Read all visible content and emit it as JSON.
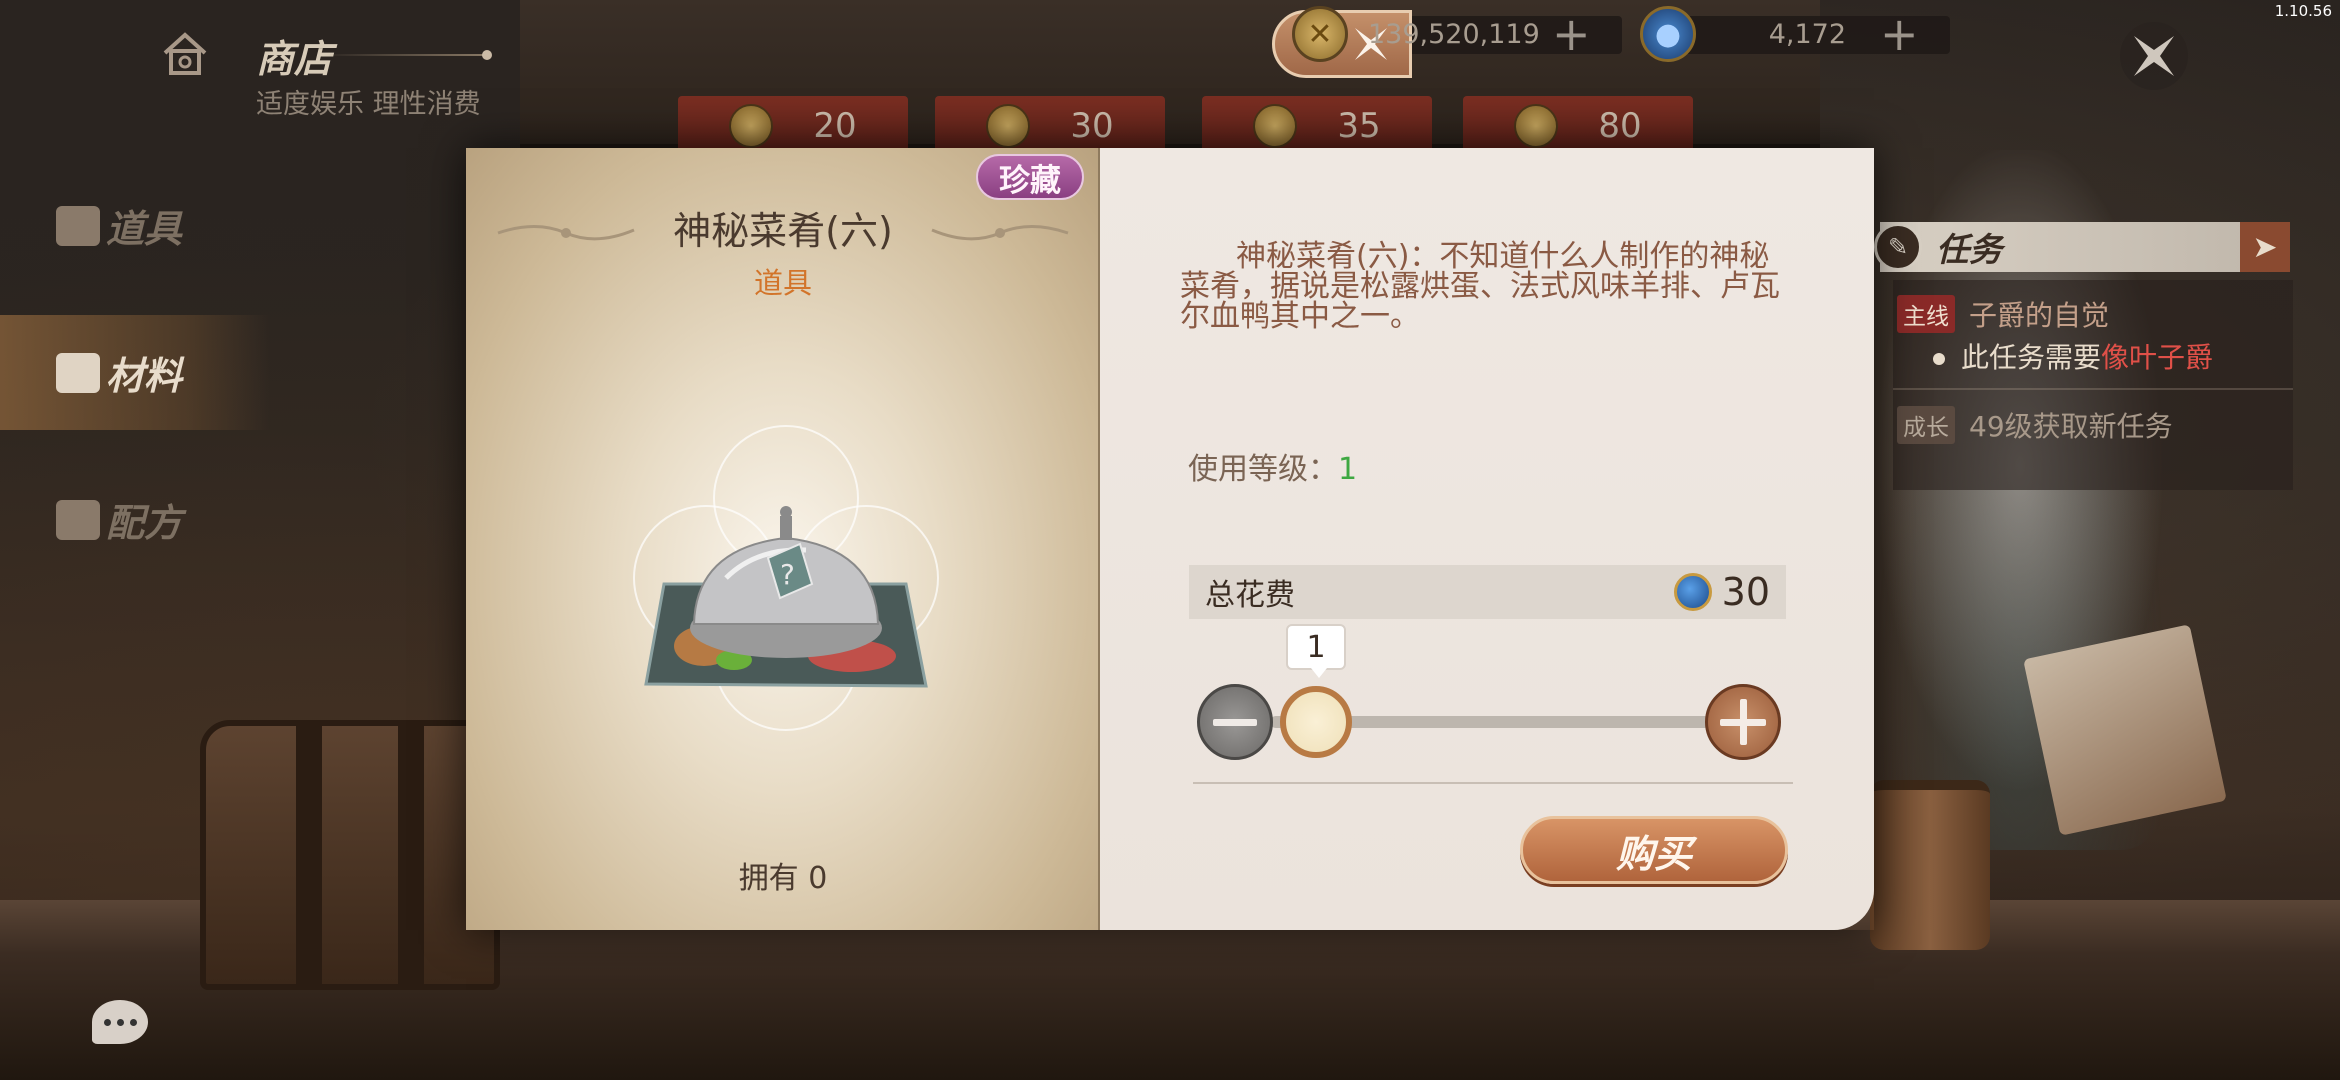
{
  "version": "1.10.56",
  "header": {
    "title": "商店",
    "subtitle": "适度娱乐 理性消费",
    "currencies": [
      {
        "icon": "gold-coin-icon",
        "value": "139,520,119"
      },
      {
        "icon": "blue-gem-icon",
        "value": "4,172"
      }
    ]
  },
  "price_tabs": [
    "20",
    "30",
    "35",
    "80"
  ],
  "sidebar": {
    "items": [
      {
        "label": "道具",
        "active": false
      },
      {
        "label": "材料",
        "active": true
      },
      {
        "label": "配方",
        "active": false
      }
    ]
  },
  "quest": {
    "title": "任务",
    "main_tag": "主线",
    "main_text": "子爵的自觉",
    "sub_text": "此任务需要",
    "sub_highlight": "像叶子爵",
    "grow_tag": "成长",
    "grow_text": "49级获取新任务"
  },
  "item": {
    "badge": "珍藏",
    "name": "神秘菜肴(六)",
    "type": "道具",
    "owned_label": "拥有 0",
    "description": "神秘菜肴(六)：不知道什么人制作的神秘菜肴，据说是松露烘蛋、法式风味羊排、卢瓦尔血鸭其中之一。",
    "level_label": "使用等级：",
    "level_value": "1"
  },
  "purchase": {
    "cost_label": "总花费",
    "cost_value": "30",
    "quantity": "1",
    "buy_label": "购买"
  },
  "colors": {
    "accent_orange": "#d2742a",
    "rare_purple": "#8a3f82",
    "level_green": "#3ea842",
    "quest_red": "#e05048"
  }
}
